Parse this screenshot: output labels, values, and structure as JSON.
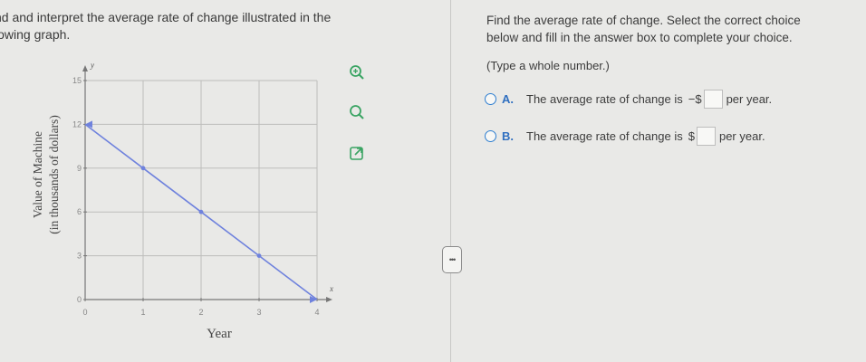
{
  "problem": {
    "line1": "nd and interpret the average rate of change illustrated in the",
    "line2": "lowing graph."
  },
  "graph": {
    "y_axis_label_1": "Value of Machine",
    "y_axis_label_2": "(in thousands of dollars)",
    "y_axis_letter": "y",
    "x_axis_label": "Year",
    "x_axis_letter": "x",
    "y_ticks": [
      "0",
      "3",
      "6",
      "9",
      "12",
      "15"
    ],
    "x_ticks": [
      "0",
      "1",
      "2",
      "3",
      "4"
    ],
    "line_color": "#6f82dd"
  },
  "chart_data": {
    "type": "line",
    "x": [
      0,
      1,
      2,
      3,
      4
    ],
    "series": [
      {
        "values": [
          12,
          9,
          6,
          3,
          0
        ]
      }
    ],
    "xlabel": "Year",
    "ylabel": "Value of Machine (in thousands of dollars)",
    "xlim": [
      0,
      4
    ],
    "ylim": [
      0,
      15
    ],
    "grid": true
  },
  "tools": {
    "zoom_in_icon": "magnifier-plus-icon",
    "zoom_out_icon": "magnifier-icon",
    "popout_icon": "external-link-icon"
  },
  "splitter": {
    "glyph": "•••"
  },
  "question": {
    "line1": "Find the average rate of change. Select the correct choice",
    "line2": "below and fill in the answer box to complete your choice.",
    "hint": "(Type a whole number.)",
    "options": [
      {
        "letter": "A.",
        "text": "The average rate of change is",
        "prefix": "−$",
        "suffix": "per year."
      },
      {
        "letter": "B.",
        "text": "The average rate of change is",
        "prefix": "$",
        "suffix": "per year."
      }
    ]
  },
  "colors": {
    "accent": "#2f7fd1",
    "tool_green": "#3aa463"
  }
}
